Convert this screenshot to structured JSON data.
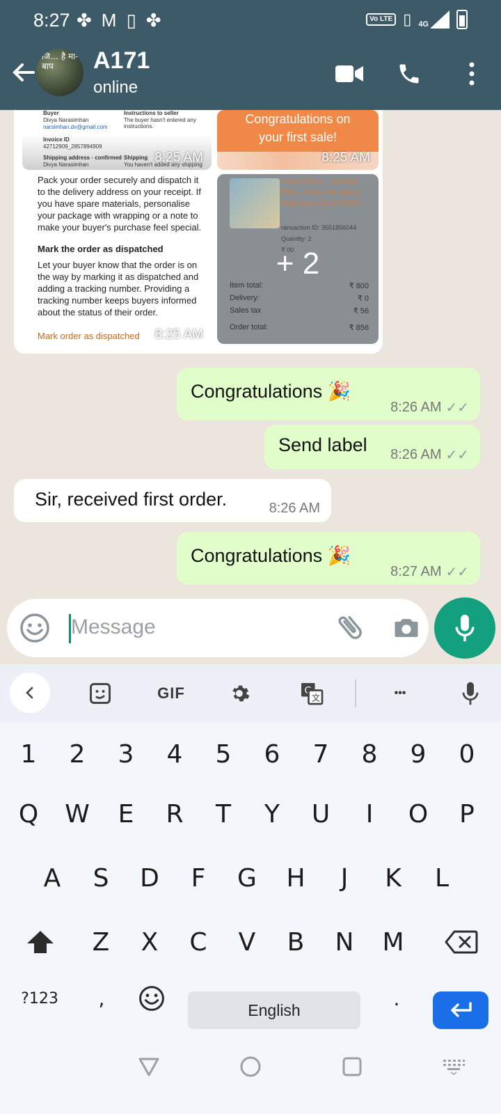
{
  "status_bar": {
    "time": "8:27",
    "network": "4G",
    "volte": "Vo LTE"
  },
  "header": {
    "contact_name": "A171",
    "presence": "online",
    "avatar_text": "जि… है मां-बाप"
  },
  "media_album": {
    "tile1": {
      "buyer_label": "Buyer",
      "buyer_name": "Divya Narasimhan",
      "email": "narsimhan.dv@gmail.com",
      "instructions_label": "Instructions to seller",
      "instructions_text": "The buyer hasn't entered any instructions.",
      "invoice_label": "Invoice ID",
      "invoice_id": "42712909_2857894909",
      "shipping_label": "Shipping address · confirmed",
      "shipping_name": "Divya Narasimhan",
      "shipping_label2": "Shipping",
      "shipping_text2": "You haven't added any shipping",
      "time": "8:25 AM"
    },
    "tile2": {
      "title_line1": "Congratulations on",
      "title_line2": "your first sale!",
      "time": "8:25 AM"
    },
    "tile3": {
      "para1": "Pack your order securely and dispatch it to the delivery address on your receipt. If you have spare materials, personalise your package with wrapping or a note to make your buyer's purchase feel special.",
      "heading": "Mark the order as dispatched",
      "para2": "Let your buyer know that the order is on the way by marking it as dispatched and adding a tracking number. Providing a tracking number keeps buyers informed about the status of their order.",
      "link": "Mark order as dispatched",
      "time": "8:25 AM"
    },
    "tile4": {
      "product_text": "Home Decor , ndmade Gifts , Indian Art, Ethnic Wall Decor (12 2 INCH )",
      "transaction": "ransaction ID: 3551856044",
      "quantity": "Quantity: 2",
      "price_fragment": "₹ 00",
      "more_count": "+ 2",
      "item_total_label": "Item total:",
      "item_total": "₹ 800",
      "delivery_label": "Delivery:",
      "delivery": "₹ 0",
      "tax_label": "Sales tax",
      "tax": "₹ 56",
      "order_total_label": "Order total:",
      "order_total": "₹ 856"
    }
  },
  "messages": [
    {
      "direction": "out",
      "text": "Congratulations 🎉",
      "time": "8:26 AM"
    },
    {
      "direction": "out",
      "text": "Send label",
      "time": "8:26 AM"
    },
    {
      "direction": "in",
      "text": "Sir, received first order.",
      "time": "8:26 AM"
    },
    {
      "direction": "out",
      "text": "Congratulations 🎉",
      "time": "8:27 AM"
    }
  ],
  "composer": {
    "placeholder": "Message"
  },
  "keyboard": {
    "toolbar_gif": "GIF",
    "toolbar_more": "•••",
    "numbers": [
      "1",
      "2",
      "3",
      "4",
      "5",
      "6",
      "7",
      "8",
      "9",
      "0"
    ],
    "row1": [
      "Q",
      "W",
      "E",
      "R",
      "T",
      "Y",
      "U",
      "I",
      "O",
      "P"
    ],
    "row2": [
      "A",
      "S",
      "D",
      "F",
      "G",
      "H",
      "J",
      "K",
      "L"
    ],
    "row3": [
      "Z",
      "X",
      "C",
      "V",
      "B",
      "N",
      "M"
    ],
    "symbols_key": "?123",
    "comma_key": ",",
    "space_label": "English",
    "period_key": "."
  },
  "colors": {
    "header_bg": "#3c5a68",
    "outgoing_bubble": "#e1fdc9",
    "accent_green": "#12a07f",
    "enter_blue": "#1a6ee8"
  }
}
